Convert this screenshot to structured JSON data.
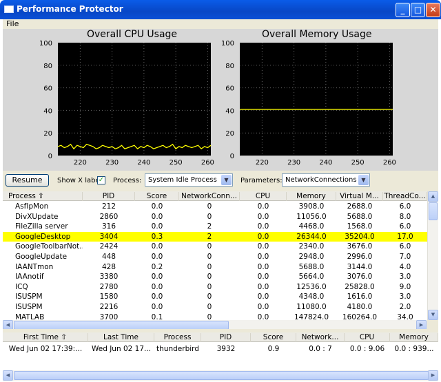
{
  "window": {
    "title": "Performance Protector"
  },
  "menu": {
    "file": "File"
  },
  "cpu_chart": {
    "title": "Overall CPU Usage",
    "y_ticks": [
      "100",
      "80",
      "60",
      "40",
      "20",
      "0"
    ],
    "x_ticks": [
      "220",
      "230",
      "240",
      "250",
      "260"
    ],
    "line_color": "#ffff00",
    "bg_color": "#000000"
  },
  "mem_chart": {
    "title": "Overall Memory Usage",
    "y_ticks": [
      "100",
      "80",
      "60",
      "40",
      "20",
      "0"
    ],
    "x_ticks": [
      "220",
      "230",
      "240",
      "250",
      "260"
    ],
    "line_color": "#ffff00",
    "bg_color": "#000000"
  },
  "chart_data": [
    {
      "type": "line",
      "title": "Overall CPU Usage",
      "ylim": [
        0,
        100
      ],
      "xlim": [
        213,
        261
      ],
      "x": [
        213,
        214,
        215,
        216,
        217,
        218,
        219,
        220,
        221,
        222,
        223,
        224,
        225,
        226,
        227,
        228,
        229,
        230,
        231,
        232,
        233,
        234,
        235,
        236,
        237,
        238,
        239,
        240,
        241,
        242,
        243,
        244,
        245,
        246,
        247,
        248,
        249,
        250,
        251,
        252,
        253,
        254,
        255,
        256,
        257,
        258,
        259,
        260,
        261
      ],
      "y": [
        8,
        9,
        7,
        8,
        10,
        6,
        9,
        8,
        7,
        10,
        9,
        8,
        6,
        7,
        9,
        8,
        7,
        8,
        6,
        7,
        9,
        6,
        7,
        8,
        9,
        6,
        8,
        7,
        9,
        8,
        6,
        7,
        8,
        9,
        7,
        8,
        10,
        6,
        8,
        7,
        9,
        8,
        7,
        8,
        9,
        6,
        8,
        7,
        9
      ],
      "grid": true
    },
    {
      "type": "line",
      "title": "Overall Memory Usage",
      "ylim": [
        0,
        100
      ],
      "xlim": [
        213,
        261
      ],
      "x": [
        213,
        261
      ],
      "y": [
        41,
        41
      ],
      "grid": true
    }
  ],
  "controls": {
    "resume": "Resume",
    "show_x_labels": "Show X labels",
    "process_label": "Process:",
    "process_value": "System Idle Process",
    "parameters_label": "Parameters:",
    "parameters_value": "NetworkConnections",
    "checkmark": "✓"
  },
  "process_table": {
    "columns": [
      "Process  ⇧",
      "PID",
      "Score",
      "NetworkConn...",
      "CPU",
      "Memory",
      "Virtual M...",
      "ThreadCo..."
    ],
    "rows": [
      [
        "AsfIpMon",
        "212",
        "0.0",
        "0",
        "0.0",
        "3908.0",
        "2688.0",
        "6.0"
      ],
      [
        "DivXUpdate",
        "2860",
        "0.0",
        "0",
        "0.0",
        "11056.0",
        "5688.0",
        "8.0"
      ],
      [
        "FileZilla server",
        "316",
        "0.0",
        "2",
        "0.0",
        "4468.0",
        "1568.0",
        "6.0"
      ],
      [
        "GoogleDesktop",
        "3404",
        "0.3",
        "2",
        "0.0",
        "26344.0",
        "35204.0",
        "17.0"
      ],
      [
        "GoogleToolbarNot...",
        "2424",
        "0.0",
        "0",
        "0.0",
        "2340.0",
        "3676.0",
        "6.0"
      ],
      [
        "GoogleUpdate",
        "448",
        "0.0",
        "0",
        "0.0",
        "2948.0",
        "2996.0",
        "7.0"
      ],
      [
        "IAANTmon",
        "428",
        "0.2",
        "0",
        "0.0",
        "5688.0",
        "3144.0",
        "4.0"
      ],
      [
        "IAAnotif",
        "3380",
        "0.0",
        "0",
        "0.0",
        "5664.0",
        "3076.0",
        "3.0"
      ],
      [
        "ICQ",
        "2780",
        "0.0",
        "0",
        "0.0",
        "12536.0",
        "25828.0",
        "9.0"
      ],
      [
        "ISUSPM",
        "1580",
        "0.0",
        "0",
        "0.0",
        "4348.0",
        "1616.0",
        "3.0"
      ],
      [
        "ISUSPM",
        "2216",
        "0.0",
        "0",
        "0.0",
        "11080.0",
        "4180.0",
        "2.0"
      ],
      [
        "MATLAB",
        "3700",
        "0.1",
        "0",
        "0.0",
        "147824.0",
        "160264.0",
        "34.0"
      ]
    ],
    "selected_index": 3
  },
  "history_table": {
    "columns": [
      "First Time  ⇧",
      "Last Time",
      "Process",
      "PID",
      "Score",
      "Network...",
      "CPU",
      "Memory"
    ],
    "rows": [
      [
        "Wed Jun 02 17:39:...",
        "Wed Jun 02 17...",
        "thunderbird",
        "3932",
        "0.9",
        "0.0 : 7",
        "0.0 : 9.06",
        "0.0 : 939..."
      ]
    ]
  }
}
